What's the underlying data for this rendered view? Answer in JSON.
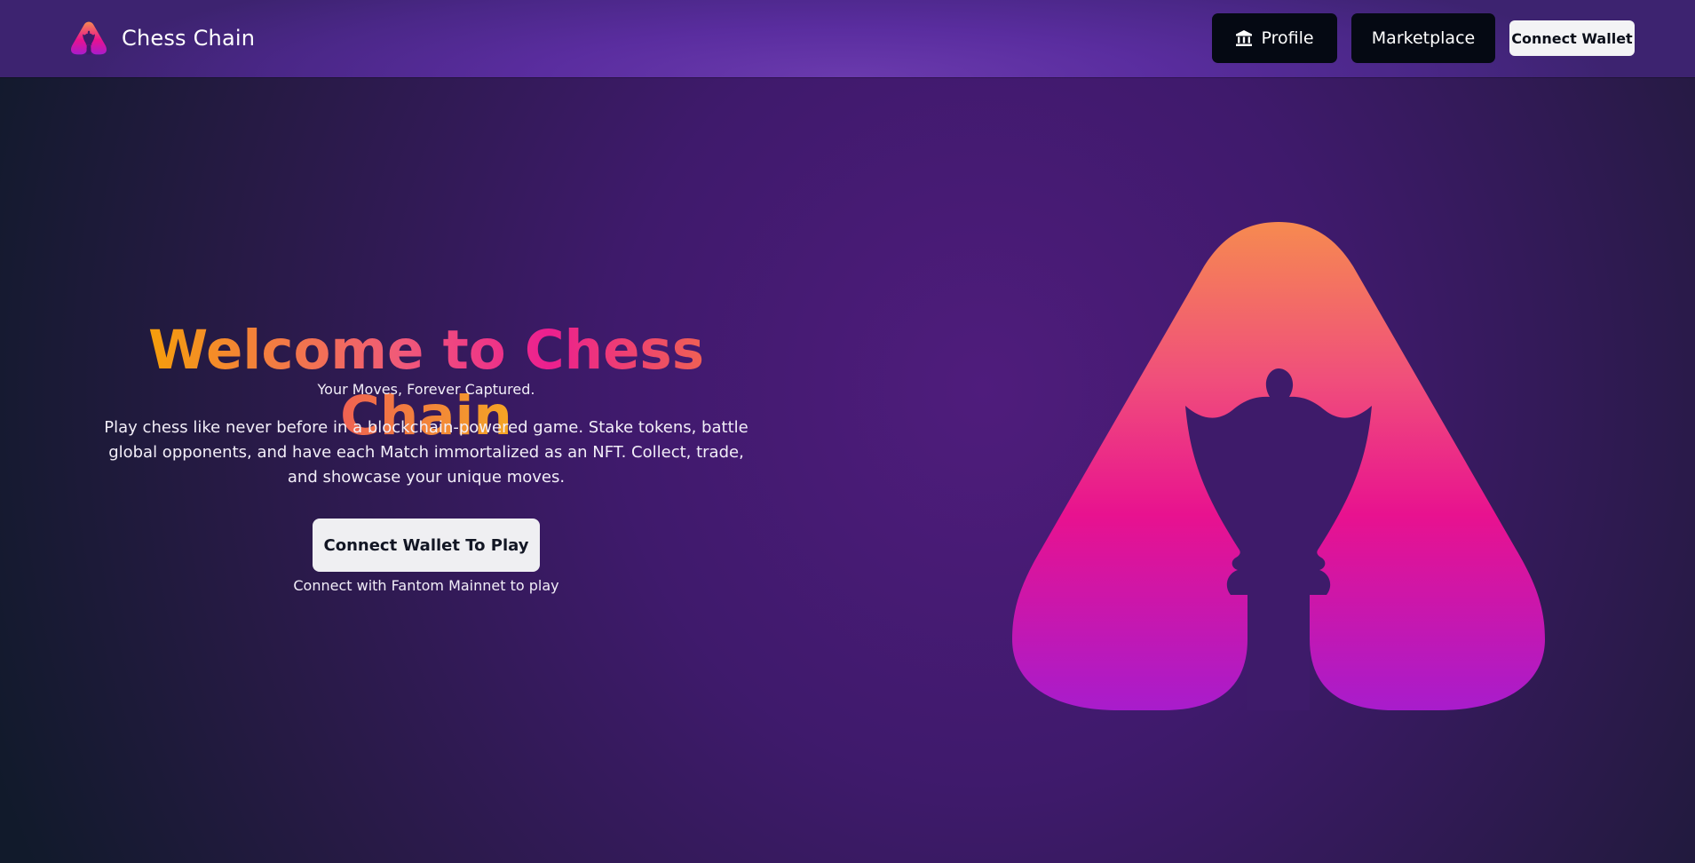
{
  "header": {
    "brand_name": "Chess Chain",
    "nav": {
      "profile_label": "Profile",
      "marketplace_label": "Marketplace",
      "connect_wallet_label": "Connect Wallet"
    },
    "icons": {
      "brand": "chess-chain-logo-icon",
      "profile": "bank-icon"
    }
  },
  "hero": {
    "title": "Welcome to Chess Chain",
    "tagline": "Your Moves, Forever Captured.",
    "description": "Play chess like never before in a blockchain-powered game. Stake tokens, battle global opponents, and have each Match immortalized as an NFT. Collect, trade, and showcase your unique moves.",
    "cta_label": "Connect Wallet To Play",
    "cta_note": "Connect with Fantom Mainnet to play"
  },
  "colors": {
    "background": "#2a1848",
    "navbar": "#5a2d9f",
    "logo_gradient": [
      "#f68a50",
      "#e8128f",
      "#a81ccc"
    ],
    "title_gradient": [
      "#f59e0b",
      "#ec1f8f",
      "#f5a623"
    ],
    "dark_button": "#050913",
    "light_button": "#efeff2"
  }
}
